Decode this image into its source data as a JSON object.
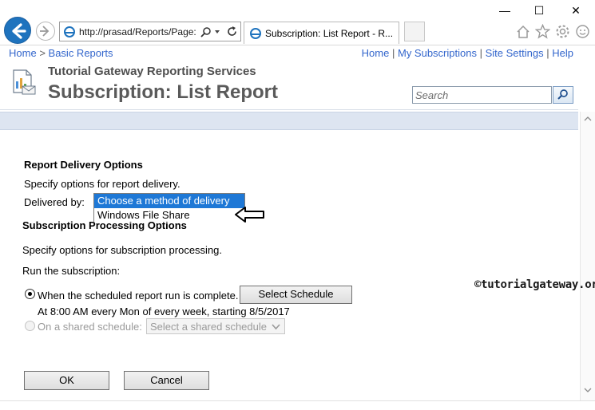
{
  "browser": {
    "address_url": "http://prasad/Reports/Page:",
    "tab_title": "Subscription: List Report - R...",
    "window_controls": {
      "minimize": "—",
      "maximize": "☐",
      "close": "✕"
    }
  },
  "breadcrumb": {
    "home": "Home",
    "sep": ">",
    "current": "Basic Reports"
  },
  "toplinks": {
    "home": "Home",
    "my_subscriptions": "My Subscriptions",
    "site_settings": "Site Settings",
    "help": "Help",
    "sep": "|"
  },
  "header": {
    "site_title": "Tutorial Gateway Reporting Services",
    "page_title": "Subscription: List Report",
    "search_placeholder": "Search"
  },
  "delivery": {
    "heading": "Report Delivery Options",
    "instructions": "Specify options for report delivery.",
    "delivered_by_label": "Delivered by:",
    "options": [
      "Choose a method of delivery",
      "Windows File Share"
    ],
    "selected_option": "Choose a method of delivery"
  },
  "processing": {
    "heading": "Subscription Processing Options",
    "instructions": "Specify options for subscription processing.",
    "run_label": "Run the subscription:",
    "scheduled_option_label": "When the scheduled report run is complete.",
    "select_schedule_button": "Select Schedule",
    "schedule_description": "At 8:00 AM every Mon of every week, starting 8/5/2017",
    "shared_option_label": "On a shared schedule:",
    "shared_select_placeholder": "Select a shared schedule"
  },
  "actions": {
    "ok": "OK",
    "cancel": "Cancel"
  },
  "watermark": "©tutorialgateway.org",
  "colors": {
    "link": "#3366cc",
    "accent_bar": "#dde5f1",
    "selected_option": "#1e78d6"
  }
}
